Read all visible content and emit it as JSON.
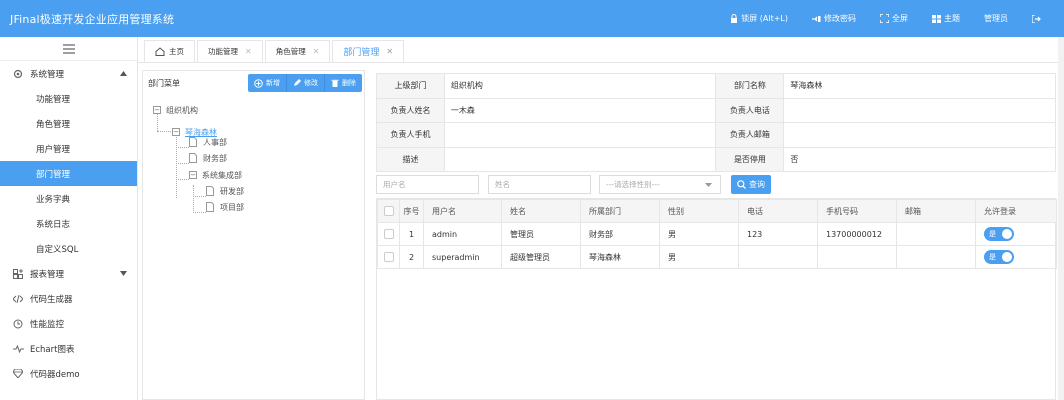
{
  "header": {
    "title": "JFinal极速开发企业应用管理系统",
    "lock_label": "锁屏 (Alt+L)",
    "password_label": "修改密码",
    "fullscreen_label": "全屏",
    "theme_label": "主题",
    "user_label": "管理员",
    "logout_icon": "logout-icon",
    "bg_color": "#4a9ff0"
  },
  "sidebar": {
    "toggle_icon": "hamburger-icon",
    "groups": [
      {
        "label": "系统管理",
        "icon": "gear-icon",
        "expanded": true,
        "items": [
          "功能管理",
          "角色管理",
          "用户管理",
          "部门管理",
          "业务字典",
          "系统日志",
          "自定义SQL"
        ],
        "active": "部门管理"
      },
      {
        "label": "报表管理",
        "icon": "chart-icon",
        "expanded": false
      },
      {
        "label": "代码生成器",
        "icon": "code-icon"
      },
      {
        "label": "性能监控",
        "icon": "monitor-icon"
      },
      {
        "label": "Echart图表",
        "icon": "pulse-icon"
      },
      {
        "label": "代码器demo",
        "icon": "diamond-icon"
      }
    ]
  },
  "tabs": [
    {
      "label": "主页",
      "icon": "home-icon",
      "closable": false
    },
    {
      "label": "功能管理",
      "closable": true
    },
    {
      "label": "角色管理",
      "closable": true
    },
    {
      "label": "部门管理",
      "closable": true,
      "active": true
    }
  ],
  "tree_panel": {
    "title": "部门菜单",
    "buttons": {
      "add": "新增",
      "edit": "修改",
      "delete": "删除"
    },
    "nodes": {
      "root": "组织机构",
      "company": "琴海森林",
      "hr": "人事部",
      "finance": "财务部",
      "integration": "系统集成部",
      "rd": "研发部",
      "project": "项目部"
    }
  },
  "info": {
    "parent_label": "上级部门",
    "parent_value": "组织机构",
    "name_label": "部门名称",
    "name_value": "琴海森林",
    "leader_label": "负责人姓名",
    "leader_value": "一木森",
    "phone_label": "负责人电话",
    "phone_value": "",
    "mobile_label": "负责人手机",
    "mobile_value": "",
    "email_label": "负责人邮箱",
    "email_value": "",
    "desc_label": "描述",
    "desc_value": "",
    "disabled_label": "是否停用",
    "disabled_value": "否"
  },
  "search": {
    "username_placeholder": "用户名",
    "name_placeholder": "姓名",
    "gender_placeholder": "---请选择性别---",
    "query_label": "查询"
  },
  "grid": {
    "columns": [
      "序号",
      "用户名",
      "姓名",
      "所属部门",
      "性别",
      "电话",
      "手机号码",
      "邮箱",
      "允许登录"
    ],
    "rows": [
      {
        "no": "1",
        "username": "admin",
        "name": "管理员",
        "dept": "财务部",
        "gender": "男",
        "phone": "123",
        "mobile": "13700000012",
        "email": "",
        "allow": "是"
      },
      {
        "no": "2",
        "username": "superadmin",
        "name": "超级管理员",
        "dept": "琴海森林",
        "gender": "男",
        "phone": "",
        "mobile": "",
        "email": "",
        "allow": "是"
      }
    ]
  }
}
